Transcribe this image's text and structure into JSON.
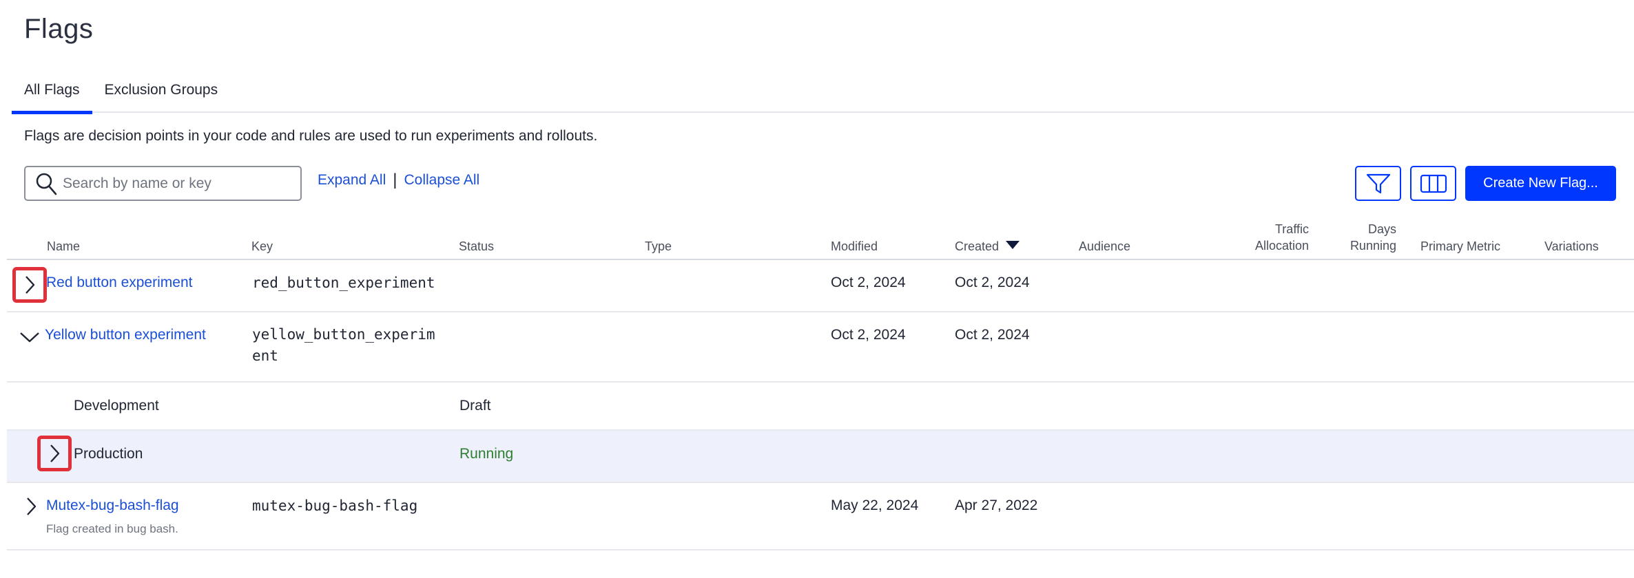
{
  "page": {
    "title": "Flags"
  },
  "tabs": [
    {
      "label": "All Flags",
      "active": true
    },
    {
      "label": "Exclusion Groups",
      "active": false
    }
  ],
  "description": "Flags are decision points in your code and rules are used to run experiments and rollouts.",
  "search": {
    "placeholder": "Search by name or key",
    "value": ""
  },
  "toolbar": {
    "expand_all": "Expand All",
    "separator": "|",
    "collapse_all": "Collapse All",
    "create_label": "Create New Flag...",
    "filter_icon": "filter-icon",
    "columns_icon": "columns-icon"
  },
  "columns": {
    "name": "Name",
    "key": "Key",
    "status": "Status",
    "type": "Type",
    "modified": "Modified",
    "created": "Created",
    "audience": "Audience",
    "traffic_1": "Traffic",
    "traffic_2": "Allocation",
    "days_1": "Days",
    "days_2": "Running",
    "primary_metric": "Primary Metric",
    "variations": "Variations"
  },
  "sort": {
    "column": "Created",
    "direction": "desc"
  },
  "rows": {
    "red": {
      "name": "Red button experiment",
      "key": "red_button_experiment",
      "modified": "Oct 2, 2024",
      "created": "Oct 2, 2024",
      "expanded": false
    },
    "yellow": {
      "name": "Yellow button experiment",
      "key_line1": "yellow_button_experim",
      "key_line2": "ent",
      "modified": "Oct 2, 2024",
      "created": "Oct 2, 2024",
      "expanded": true,
      "environments": {
        "development": {
          "name": "Development",
          "status": "Draft"
        },
        "production": {
          "name": "Production",
          "status": "Running"
        }
      }
    },
    "mutex": {
      "name": "Mutex-bug-bash-flag",
      "description": "Flag created in bug bash.",
      "key": "mutex-bug-bash-flag",
      "modified": "May 22, 2024",
      "created": "Apr 27, 2022",
      "expanded": false
    }
  },
  "colors": {
    "primary": "#0037ff",
    "link": "#1a4fd6",
    "running": "#2e7d32",
    "highlight_box": "#e0313a",
    "selected_row": "#eef1fc"
  }
}
